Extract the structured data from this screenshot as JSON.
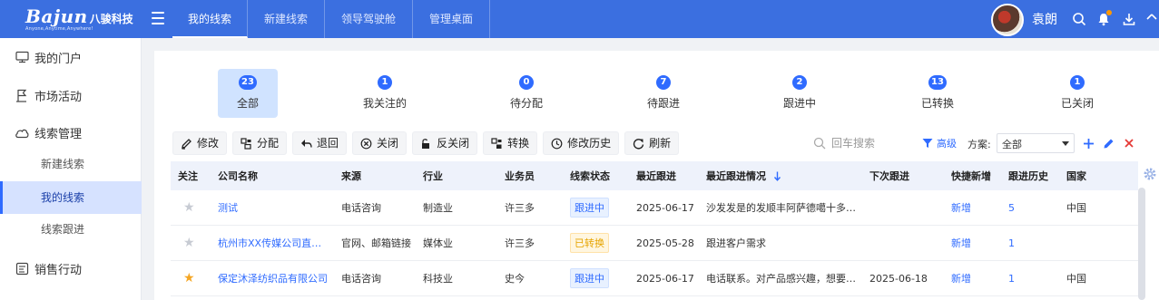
{
  "brand": {
    "name": "Bajun",
    "cn": "八骏科技",
    "tagline": "Anyone,Anytime,Anywhere!"
  },
  "topnav": {
    "tabs": [
      "我的线索",
      "新建线索",
      "领导驾驶舱",
      "管理桌面"
    ],
    "active": "我的线索",
    "username": "袁朗"
  },
  "sidebar": {
    "items": [
      {
        "label": "我的门户",
        "icon": "monitor-icon"
      },
      {
        "label": "市场活动",
        "icon": "flag-icon"
      },
      {
        "label": "线索管理",
        "icon": "cloud-icon"
      },
      {
        "label": "新建线索",
        "sub": true
      },
      {
        "label": "我的线索",
        "sub": true,
        "active": true
      },
      {
        "label": "线索跟进",
        "sub": true
      },
      {
        "label": "销售行动",
        "icon": "document-icon"
      }
    ]
  },
  "status_tabs": [
    {
      "count": "23",
      "label": "全部",
      "active": true
    },
    {
      "count": "1",
      "label": "我关注的"
    },
    {
      "count": "0",
      "label": "待分配"
    },
    {
      "count": "7",
      "label": "待跟进"
    },
    {
      "count": "2",
      "label": "跟进中"
    },
    {
      "count": "13",
      "label": "已转换"
    },
    {
      "count": "1",
      "label": "已关闭"
    }
  ],
  "toolbar": {
    "buttons": [
      {
        "label": "修改",
        "icon": "edit-icon"
      },
      {
        "label": "分配",
        "icon": "assign-icon"
      },
      {
        "label": "退回",
        "icon": "return-icon"
      },
      {
        "label": "关闭",
        "icon": "close-circle-icon"
      },
      {
        "label": "反关闭",
        "icon": "unlock-icon"
      },
      {
        "label": "转换",
        "icon": "convert-icon"
      },
      {
        "label": "修改历史",
        "icon": "history-icon"
      },
      {
        "label": "刷新",
        "icon": "refresh-icon"
      }
    ],
    "search_placeholder": "回车搜索",
    "filter_label": "高级",
    "scheme_label": "方案:",
    "scheme_value": "全部"
  },
  "table": {
    "columns": [
      "关注",
      "公司名称",
      "来源",
      "行业",
      "业务员",
      "线索状态",
      "最近跟进",
      "最近跟进情况",
      "下次跟进",
      "快捷新增",
      "跟进历史",
      "国家"
    ],
    "rows": [
      {
        "starred": false,
        "company": "测试",
        "source": "电话咨询",
        "industry": "制造业",
        "sales": "许三多",
        "status": "跟进中",
        "status_color": "#2f6bff",
        "last_follow": "2025-06-17",
        "last_note": "沙发发是的发顺丰阿萨德噶十多…",
        "next_follow": "",
        "quick_add": "新增",
        "history": "5",
        "country": "中国"
      },
      {
        "starred": false,
        "company": "杭州市XX传媒公司直…",
        "source": "官网、邮箱链接",
        "industry": "媒体业",
        "sales": "许三多",
        "status": "已转换",
        "status_color": "#e6a400",
        "last_follow": "2025-05-28",
        "last_note": "跟进客户需求",
        "next_follow": "",
        "quick_add": "新增",
        "history": "1",
        "country": ""
      },
      {
        "starred": true,
        "company": "保定沐泽纺织品有限公司",
        "source": "电话咨询",
        "industry": "科技业",
        "sales": "史今",
        "status": "跟进中",
        "status_color": "#2f6bff",
        "last_follow": "2025-06-17",
        "last_note": "电话联系。对产品感兴趣，想要…",
        "next_follow": "2025-06-18",
        "quick_add": "新增",
        "history": "1",
        "country": "中国"
      }
    ]
  },
  "colors": {
    "primary": "#3b6fe0",
    "accent": "#2f6bff",
    "star_on": "#f5a623",
    "star_off": "#c7cbd3"
  }
}
